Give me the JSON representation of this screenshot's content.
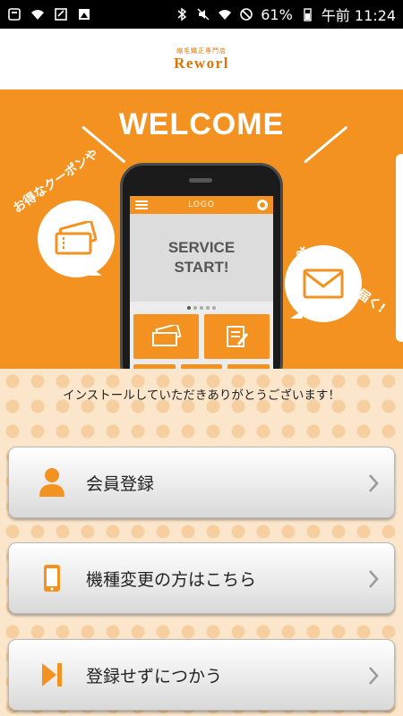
{
  "status_bar": {
    "battery_percent": "61%",
    "time": "午前 11:24"
  },
  "header": {
    "brand_sub": "縮毛矯正専門店",
    "brand_main": "Reworl"
  },
  "hero": {
    "welcome": "WELCOME",
    "left_caption": "お得なクーポンや",
    "right_caption": "お店の情報が届く!",
    "screen_logo": "LOGO",
    "screen_text_line1": "SERVICE",
    "screen_text_line2": "START!"
  },
  "content": {
    "thanks": "インストールしていただきありがとうございます！"
  },
  "buttons": [
    {
      "label": "会員登録",
      "icon": "person-icon"
    },
    {
      "label": "機種変更の方はこちら",
      "icon": "smartphone-icon"
    },
    {
      "label": "登録せずにつかう",
      "icon": "skip-icon"
    }
  ],
  "colors": {
    "accent": "#f39220",
    "brand": "#d6760c",
    "dot_bg": "#fbe6cc"
  }
}
